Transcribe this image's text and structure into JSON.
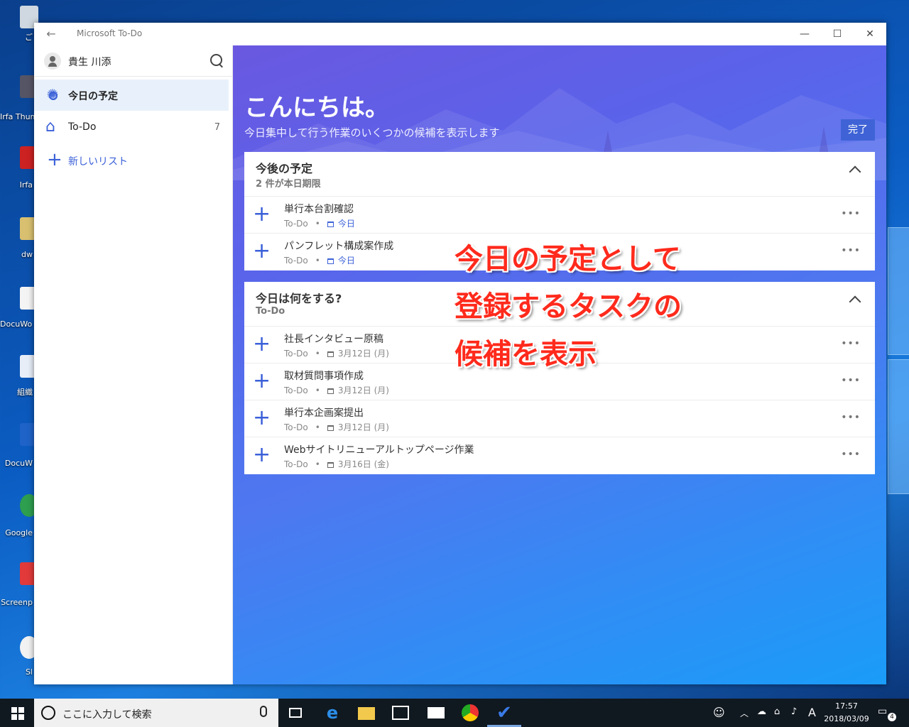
{
  "window": {
    "title": "Microsoft To-Do",
    "back_glyph": "←",
    "minimize_glyph": "—",
    "maximize_glyph": "☐",
    "close_glyph": "✕"
  },
  "sidebar": {
    "user_name": "貴生 川添",
    "items": [
      {
        "label": "今日の予定",
        "icon": "sun-icon",
        "count": ""
      },
      {
        "label": "To-Do",
        "icon": "home-icon",
        "count": "7"
      },
      {
        "label": "新しいリスト",
        "icon": "plus-icon",
        "count": ""
      }
    ]
  },
  "main": {
    "greeting": "こんにちは。",
    "subtitle": "今日集中して行う作業のいくつかの候補を表示します",
    "done_label": "完了",
    "sections": [
      {
        "title": "今後の予定",
        "subtitle": "2 件が本日期限",
        "tasks": [
          {
            "name": "単行本台割確認",
            "list": "To-Do",
            "due": "今日"
          },
          {
            "name": "パンフレット構成案作成",
            "list": "To-Do",
            "due": "今日"
          }
        ]
      },
      {
        "title": "今日は何をする?",
        "subtitle": "To-Do",
        "tasks": [
          {
            "name": "社長インタビュー原稿",
            "list": "To-Do",
            "due": "3月12日 (月)"
          },
          {
            "name": "取材質問事項作成",
            "list": "To-Do",
            "due": "3月12日 (月)"
          },
          {
            "name": "単行本企画案提出",
            "list": "To-Do",
            "due": "3月12日 (月)"
          },
          {
            "name": "Webサイトリニューアルトップページ作業",
            "list": "To-Do",
            "due": "3月16日 (金)"
          }
        ]
      }
    ],
    "task_more_glyph": "•••",
    "task_dot": "•",
    "task_add_glyph": "+"
  },
  "annotation": {
    "lines": [
      "今日の予定として",
      "登録するタスクの",
      "候補を表示"
    ],
    "color": "#ff2a1c"
  },
  "desktop": {
    "icons": [
      "ご",
      "Irfa Thum",
      "Irfa",
      "dw",
      "DocuWo 用す",
      "組織",
      "DocuW",
      "Google",
      "Screenp",
      "Sl"
    ]
  },
  "taskbar": {
    "search_placeholder": "ここに入力して検索",
    "ime": "A",
    "time": "17:57",
    "date": "2018/03/09",
    "notification_count": "4"
  },
  "colors": {
    "accent": "#3a60d8",
    "main_gradient_start": "#6a58e0",
    "main_gradient_end": "#1a9cf8"
  }
}
